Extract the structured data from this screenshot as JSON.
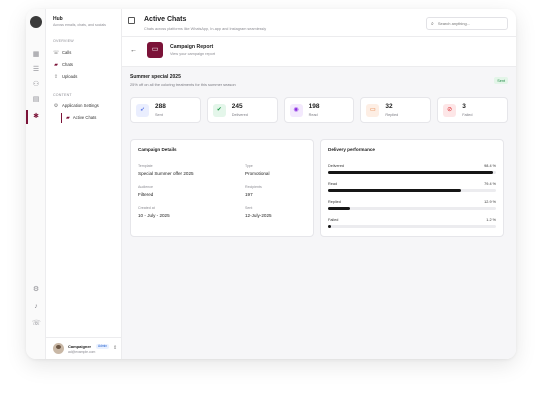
{
  "sidebar": {
    "app_name": "Hub",
    "app_subtitle": "Across emails, chats, and socials",
    "overview_label": "OVERVIEW",
    "content_label": "CONTENT",
    "items": [
      {
        "label": "Calls",
        "icon": "phone-icon"
      },
      {
        "label": "Chats",
        "icon": "chat-icon"
      },
      {
        "label": "Uploads",
        "icon": "upload-icon"
      },
      {
        "label": "Application Settings",
        "icon": "settings-icon"
      },
      {
        "label": "Active Chats",
        "icon": "chat-icon"
      }
    ],
    "user": {
      "name": "Campaigner",
      "role": "Admin",
      "email": "ad@example.com"
    }
  },
  "header": {
    "title": "Active Chats",
    "subtitle": "Chats across platforms like WhatsApp, In-app and Instagram seamlessly",
    "search_placeholder": "Search anything..."
  },
  "report": {
    "title": "Campaign Report",
    "subtitle": "View your campaign report"
  },
  "campaign": {
    "name": "Summer special 2025",
    "description": "25% off on all the coloring treatments for this summer season",
    "status": "Sent"
  },
  "stats": [
    {
      "value": "288",
      "label": "Sent",
      "icon": "rocket-icon",
      "color": "#2a4de0",
      "bg": "#eaeefe"
    },
    {
      "value": "245",
      "label": "Delivered",
      "icon": "check-double-icon",
      "color": "#1f9a4a",
      "bg": "#e4f6ea"
    },
    {
      "value": "198",
      "label": "Read",
      "icon": "eye-icon",
      "color": "#8a2be2",
      "bg": "#f3e9fd"
    },
    {
      "value": "32",
      "label": "Replied",
      "icon": "reply-icon",
      "color": "#e06a20",
      "bg": "#fdeee4"
    },
    {
      "value": "3",
      "label": "Failed",
      "icon": "alert-icon",
      "color": "#d9262b",
      "bg": "#fde6e7"
    }
  ],
  "details": {
    "title": "Campaign Details",
    "template_label": "Template",
    "template_value": "Special Summer offer 2025",
    "type_label": "Type",
    "type_value": "Promotional",
    "audience_label": "Audience",
    "audience_value": "Filtered",
    "recipients_label": "Recipients",
    "recipients_value": "197",
    "created_label": "Created at",
    "created_value": "10 - July - 2025",
    "sent_label": "Sent",
    "sent_value": "12-July-2025"
  },
  "performance": {
    "title": "Delivery performance",
    "rows": [
      {
        "label": "Delivered",
        "value": "98.4 %",
        "pct": 98.4
      },
      {
        "label": "Read",
        "value": "79.4 %",
        "pct": 79.4
      },
      {
        "label": "Replied",
        "value": "12.9 %",
        "pct": 12.9
      },
      {
        "label": "Failed",
        "value": "1.2 %",
        "pct": 1.2
      }
    ]
  }
}
